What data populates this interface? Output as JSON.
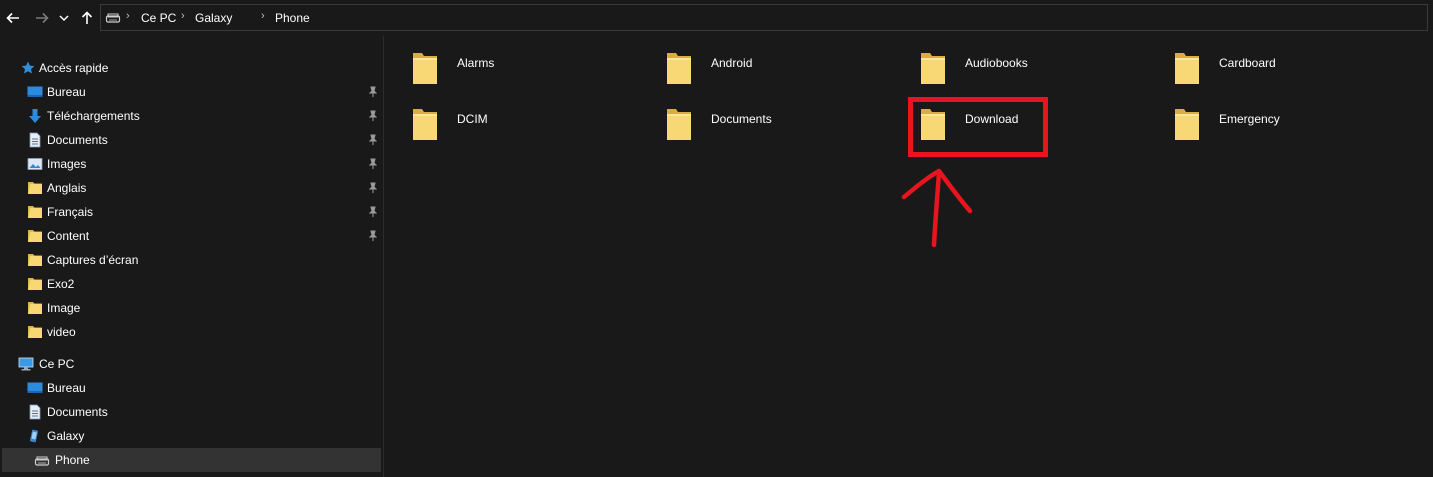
{
  "nav": {
    "back_icon": "arrow-left-icon",
    "forward_icon": "arrow-right-icon",
    "recent_icon": "chevron-down-icon",
    "up_icon": "arrow-up-icon"
  },
  "address_bar": {
    "drive_icon": "phone-drive-icon",
    "breadcrumbs": [
      "Ce PC",
      "Galaxy",
      "Phone"
    ]
  },
  "sidebar": {
    "quick_access": {
      "label": "Accès rapide",
      "items": [
        {
          "label": "Bureau",
          "icon": "desktop-icon",
          "pinned": true
        },
        {
          "label": "Téléchargements",
          "icon": "download-icon",
          "pinned": true
        },
        {
          "label": "Documents",
          "icon": "document-icon",
          "pinned": true
        },
        {
          "label": "Images",
          "icon": "images-icon",
          "pinned": true
        },
        {
          "label": "Anglais",
          "icon": "folder-icon",
          "pinned": true
        },
        {
          "label": "Français",
          "icon": "folder-icon",
          "pinned": true
        },
        {
          "label": "Content",
          "icon": "folder-icon",
          "pinned": true
        },
        {
          "label": "Captures d’écran",
          "icon": "folder-icon",
          "pinned": false
        },
        {
          "label": "Exo2",
          "icon": "folder-icon",
          "pinned": false
        },
        {
          "label": "Image",
          "icon": "folder-icon",
          "pinned": false
        },
        {
          "label": "video",
          "icon": "folder-icon",
          "pinned": false
        }
      ]
    },
    "this_pc": {
      "label": "Ce PC",
      "items": [
        {
          "label": "Bureau",
          "icon": "desktop-icon"
        },
        {
          "label": "Documents",
          "icon": "document-icon"
        },
        {
          "label": "Galaxy",
          "icon": "phone-icon"
        },
        {
          "label": "Phone",
          "icon": "phone-drive-icon",
          "selected": true
        }
      ]
    }
  },
  "folders": [
    "Alarms",
    "Android",
    "Audiobooks",
    "Cardboard",
    "DCIM",
    "Documents",
    "Download",
    "Emergency"
  ],
  "colors": {
    "background": "#191919",
    "selection": "#333333",
    "folder": "#f8d775",
    "annotation": "#e8141e"
  }
}
